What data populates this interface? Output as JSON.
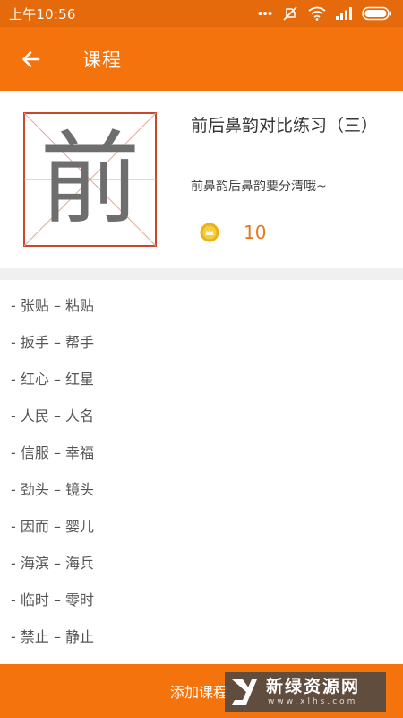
{
  "status_bar": {
    "time": "上午10:56",
    "icons": [
      "more-dots-icon",
      "mute-icon",
      "wifi-icon",
      "signal-icon",
      "battery-icon"
    ]
  },
  "app_bar": {
    "title": "课程",
    "back_icon": "back-arrow-icon"
  },
  "course": {
    "character": "前",
    "title": "前后鼻韵对比练习（三）",
    "subtitle": "前鼻韵后鼻韵要分清哦~",
    "coin_icon": "coin-icon",
    "coins": "10"
  },
  "words": [
    "- 张贴 – 粘贴",
    "- 扳手 – 帮手",
    "- 红心 – 红星",
    "- 人民 – 人名",
    "- 信服 – 幸福",
    "- 劲头 – 镜头",
    "- 因而 – 婴儿",
    "- 海滨 – 海兵",
    "- 临时 – 零时",
    "- 禁止 – 静止"
  ],
  "bottom_bar": {
    "add_label": "添加课程"
  },
  "watermark": {
    "name": "新绿资源网",
    "url": "www.xlhs.com"
  },
  "colors": {
    "primary": "#f5730c",
    "status_bar": "#e56a0b",
    "grid_red": "#c8482c",
    "coin_value": "#e2791a"
  }
}
